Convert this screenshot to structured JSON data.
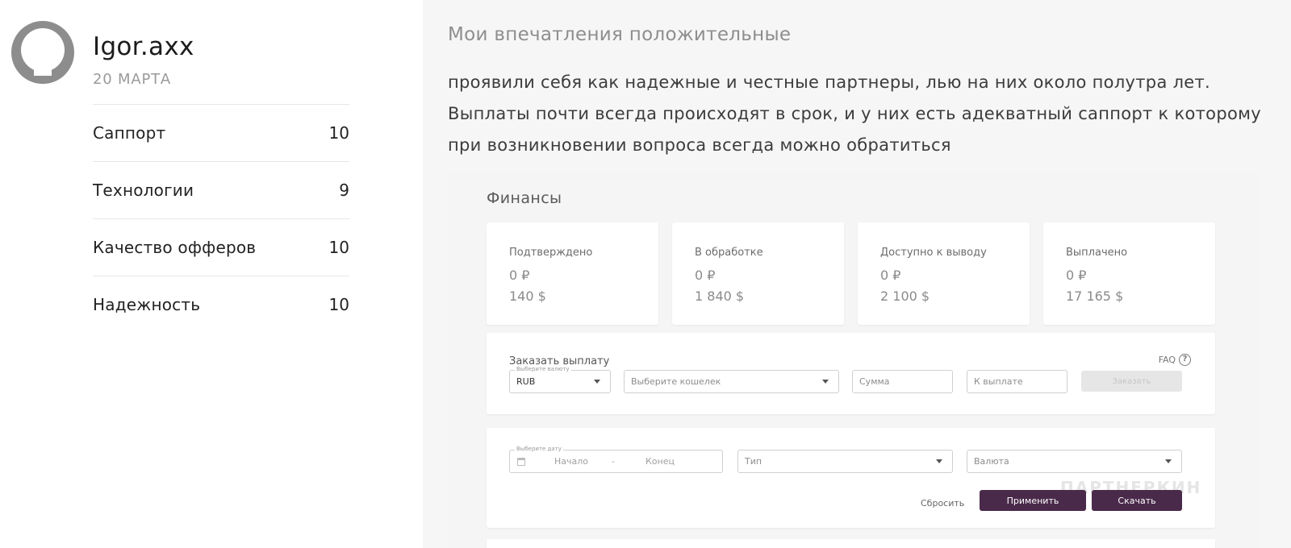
{
  "reviewer": {
    "name": "Igor.axx",
    "date": "20 МАРТА"
  },
  "ratings": [
    {
      "label": "Саппорт",
      "score": "10"
    },
    {
      "label": "Технологии",
      "score": "9"
    },
    {
      "label": "Качество офферов",
      "score": "10"
    },
    {
      "label": "Надежность",
      "score": "10"
    }
  ],
  "review": {
    "title": "Мои впечатления положительные",
    "text": "проявили себя как надежные и честные партнеры, лью на них около полутра лет. Выплаты почти всегда происходят в срок, и у них есть адекватный саппорт к которому при возникновении вопроса всегда можно обратиться"
  },
  "screenshot": {
    "title": "Финансы",
    "stats": [
      {
        "label": "Подтверждено",
        "rub": "0 ₽",
        "usd": "140 $"
      },
      {
        "label": "В обработке",
        "rub": "0 ₽",
        "usd": "1 840 $"
      },
      {
        "label": "Доступно к выводу",
        "rub": "0 ₽",
        "usd": "2 100 $"
      },
      {
        "label": "Выплачено",
        "rub": "0 ₽",
        "usd": "17 165 $"
      }
    ],
    "order": {
      "title": "Заказать выплату",
      "faq": "FAQ",
      "faq_icon": "?",
      "currency_label": "Выберите валюту",
      "currency_value": "RUB",
      "wallet_placeholder": "Выберите кошелек",
      "amount_placeholder": "Сумма",
      "payout_placeholder": "К выплате",
      "submit": "Заказать"
    },
    "filter": {
      "date_label": "Выберите дату",
      "start": "Начало",
      "dash": "-",
      "end": "Конец",
      "type": "Тип",
      "currency": "Валюта",
      "reset": "Сбросить",
      "apply": "Применить",
      "download": "Скачать"
    },
    "watermark": "ПАРТНЕРКИН"
  }
}
